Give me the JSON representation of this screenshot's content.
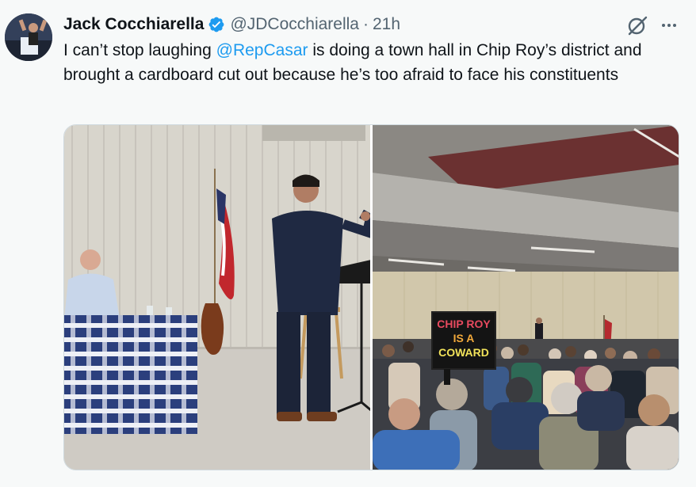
{
  "tweet": {
    "author_name": "Jack Cocchiarella",
    "handle": "@JDCocchiarella",
    "separator": "·",
    "time": "21h",
    "text_before": "I can’t stop laughing ",
    "mention": "@RepCasar",
    "text_after": " is doing a town hall in Chip Roy’s district and brought a cardboard cut out because he’s too afraid to face his constituents"
  },
  "photos": {
    "sign_line1": "CHIP ROY",
    "sign_line2": "IS A",
    "sign_line3": "COWARD"
  },
  "colors": {
    "verified_badge": "#1d9bf0",
    "mention": "#1d9bf0",
    "secondary_text": "#536471"
  },
  "icons": [
    "avatar",
    "verified-badge-icon",
    "grok-icon",
    "more-icon"
  ]
}
